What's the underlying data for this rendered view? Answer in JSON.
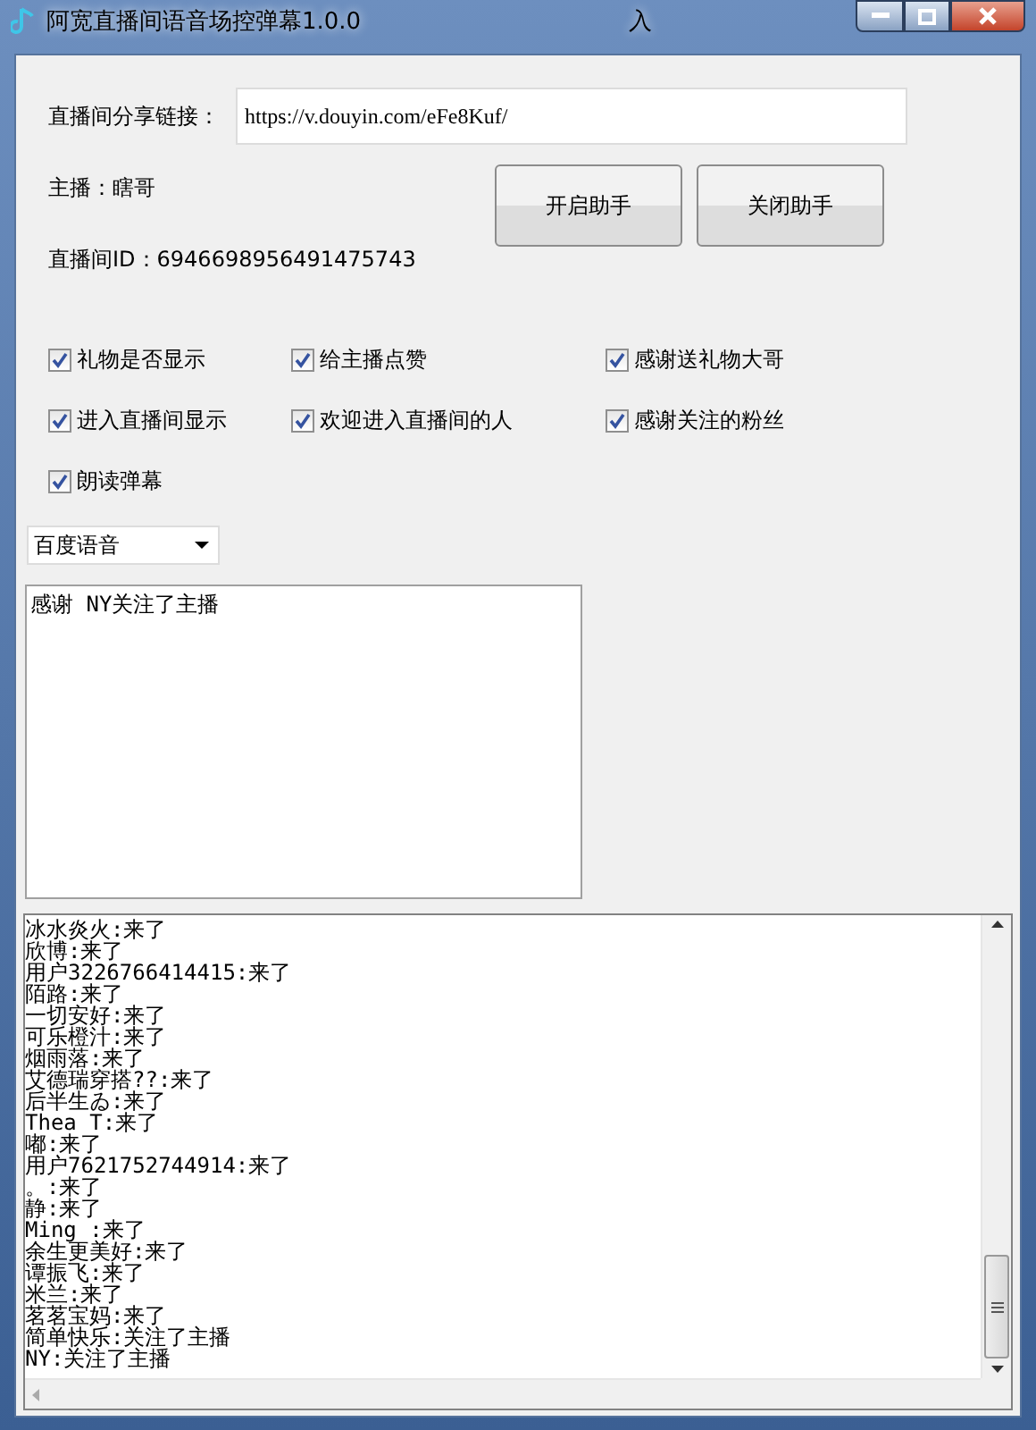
{
  "window": {
    "title": "阿宽直播间语音场控弹幕1.0.0",
    "title_tail": "入"
  },
  "share_link": {
    "label": "直播间分享链接：",
    "value": "https://v.douyin.com/eFe8Kuf/"
  },
  "host": "主播：瞎哥",
  "room_id": "直播间ID：6946698956491475743",
  "buttons": [
    "开启助手",
    "关闭助手"
  ],
  "options": [
    {
      "label": "礼物是否显示",
      "checked": true
    },
    {
      "label": "给主播点赞",
      "checked": true
    },
    {
      "label": "感谢送礼物大哥",
      "checked": true
    },
    {
      "label": "进入直播间显示",
      "checked": true
    },
    {
      "label": "欢迎进入直播间的人",
      "checked": true
    },
    {
      "label": "感谢关注的粉丝",
      "checked": true
    },
    {
      "label": "朗读弹幕",
      "checked": true
    }
  ],
  "voice_select": {
    "value": "百度语音"
  },
  "speech_text": "感谢 NY关注了主播",
  "log": [
    "冰水炎火:来了",
    "欣博:来了",
    "用户3226766414415:来了",
    "陌路:来了",
    "一切安好:来了",
    "可乐橙汁:来了",
    "烟雨落:来了",
    "艾德瑞穿搭??:来了",
    "后半生ゐ:来了",
    "Thea T:来了",
    "嘟:来了",
    "用户7621752744914:来了",
    "。:来了",
    "静:来了",
    "Ming :来了",
    "余生更美好:来了",
    "谭振飞:来了",
    "米兰:来了",
    "茗茗宝妈:来了",
    "简单快乐:关注了主播",
    "NY:关注了主播"
  ]
}
